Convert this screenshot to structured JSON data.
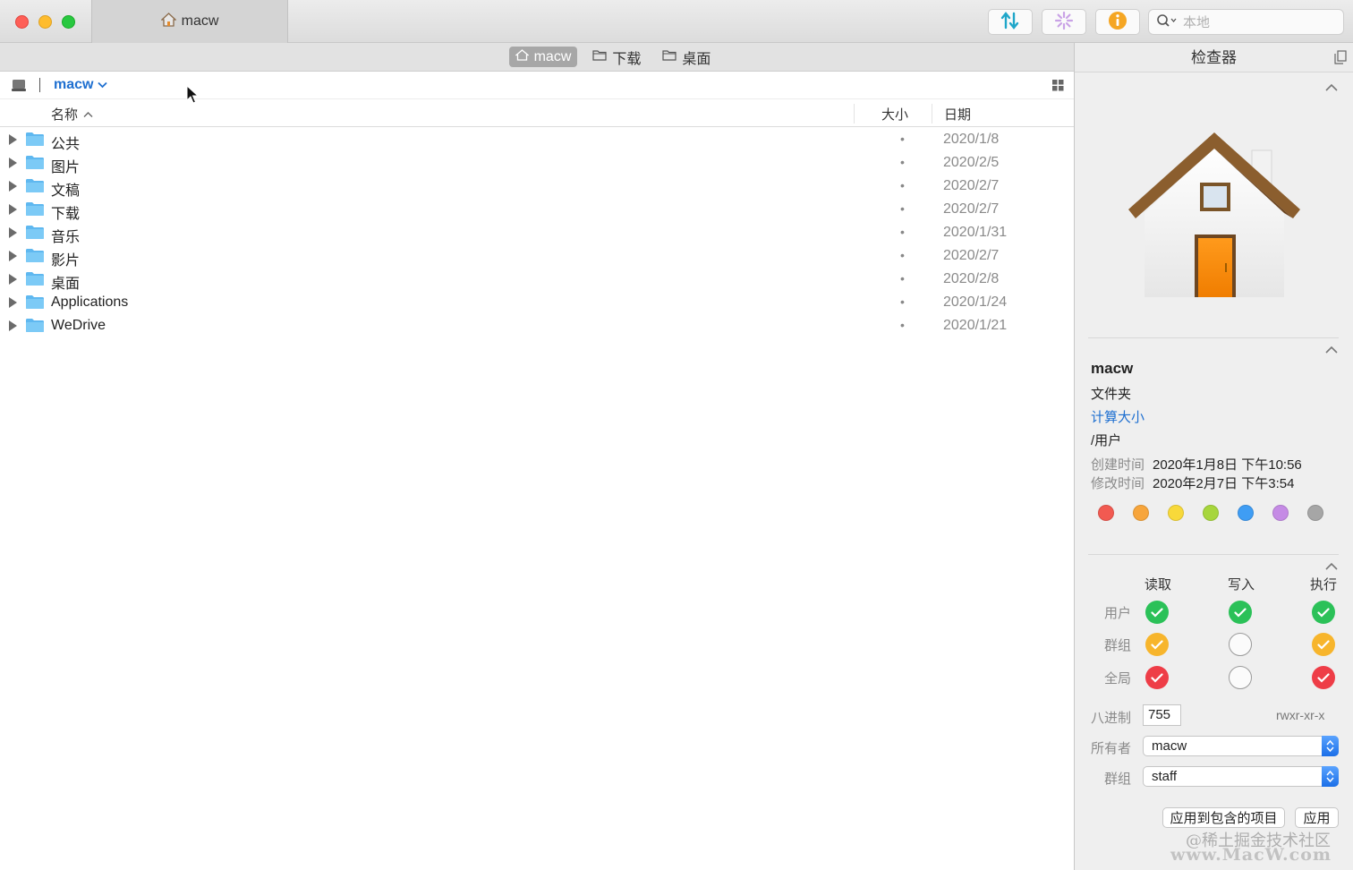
{
  "window": {
    "tab_title": "macw",
    "search_placeholder": "本地"
  },
  "pathbar": {
    "crumbs": [
      "macw",
      "下载",
      "桌面"
    ]
  },
  "location": {
    "current": "macw"
  },
  "columns": {
    "name": "名称",
    "size": "大小",
    "date": "日期"
  },
  "files": [
    {
      "name": "公共",
      "size": "•",
      "date": "2020/1/8",
      "icon": "public-folder-icon"
    },
    {
      "name": "图片",
      "size": "•",
      "date": "2020/2/5",
      "icon": "pictures-folder-icon"
    },
    {
      "name": "文稿",
      "size": "•",
      "date": "2020/2/7",
      "icon": "documents-folder-icon"
    },
    {
      "name": "下载",
      "size": "•",
      "date": "2020/2/7",
      "icon": "downloads-folder-icon"
    },
    {
      "name": "音乐",
      "size": "•",
      "date": "2020/1/31",
      "icon": "music-folder-icon"
    },
    {
      "name": "影片",
      "size": "•",
      "date": "2020/2/7",
      "icon": "movies-folder-icon"
    },
    {
      "name": "桌面",
      "size": "•",
      "date": "2020/2/8",
      "icon": "desktop-folder-icon"
    },
    {
      "name": "Applications",
      "size": "•",
      "date": "2020/1/24",
      "icon": "applications-folder-icon"
    },
    {
      "name": "WeDrive",
      "size": "•",
      "date": "2020/1/21",
      "icon": "folder-icon"
    }
  ],
  "inspector": {
    "title": "检查器",
    "name": "macw",
    "kind": "文件夹",
    "calc_size": "计算大小",
    "path": "/用户",
    "created_label": "创建时间",
    "created_value": "2020年1月8日 下午10:56",
    "modified_label": "修改时间",
    "modified_value": "2020年2月7日 下午3:54",
    "tag_colors": [
      "#f25a51",
      "#f7a53b",
      "#f8d93a",
      "#a7d63c",
      "#3f9df4",
      "#c58be5",
      "#a6a6a6"
    ],
    "permissions": {
      "headers": [
        "读取",
        "写入",
        "执行"
      ],
      "rows": [
        {
          "label": "用户",
          "states": [
            "green",
            "green",
            "green"
          ]
        },
        {
          "label": "群组",
          "states": [
            "orange",
            "empty",
            "orange"
          ]
        },
        {
          "label": "全局",
          "states": [
            "red",
            "empty",
            "red"
          ]
        }
      ]
    },
    "octal_label": "八进制",
    "octal_value": "755",
    "symbolic": "rwxr-xr-x",
    "owner_label": "所有者",
    "owner_value": "macw",
    "group_label": "群组",
    "group_value": "staff",
    "apply_enclosed": "应用到包含的项目",
    "apply": "应用"
  },
  "watermark": {
    "line1": "@稀土掘金技术社区",
    "line2": "www.MacW.com"
  }
}
